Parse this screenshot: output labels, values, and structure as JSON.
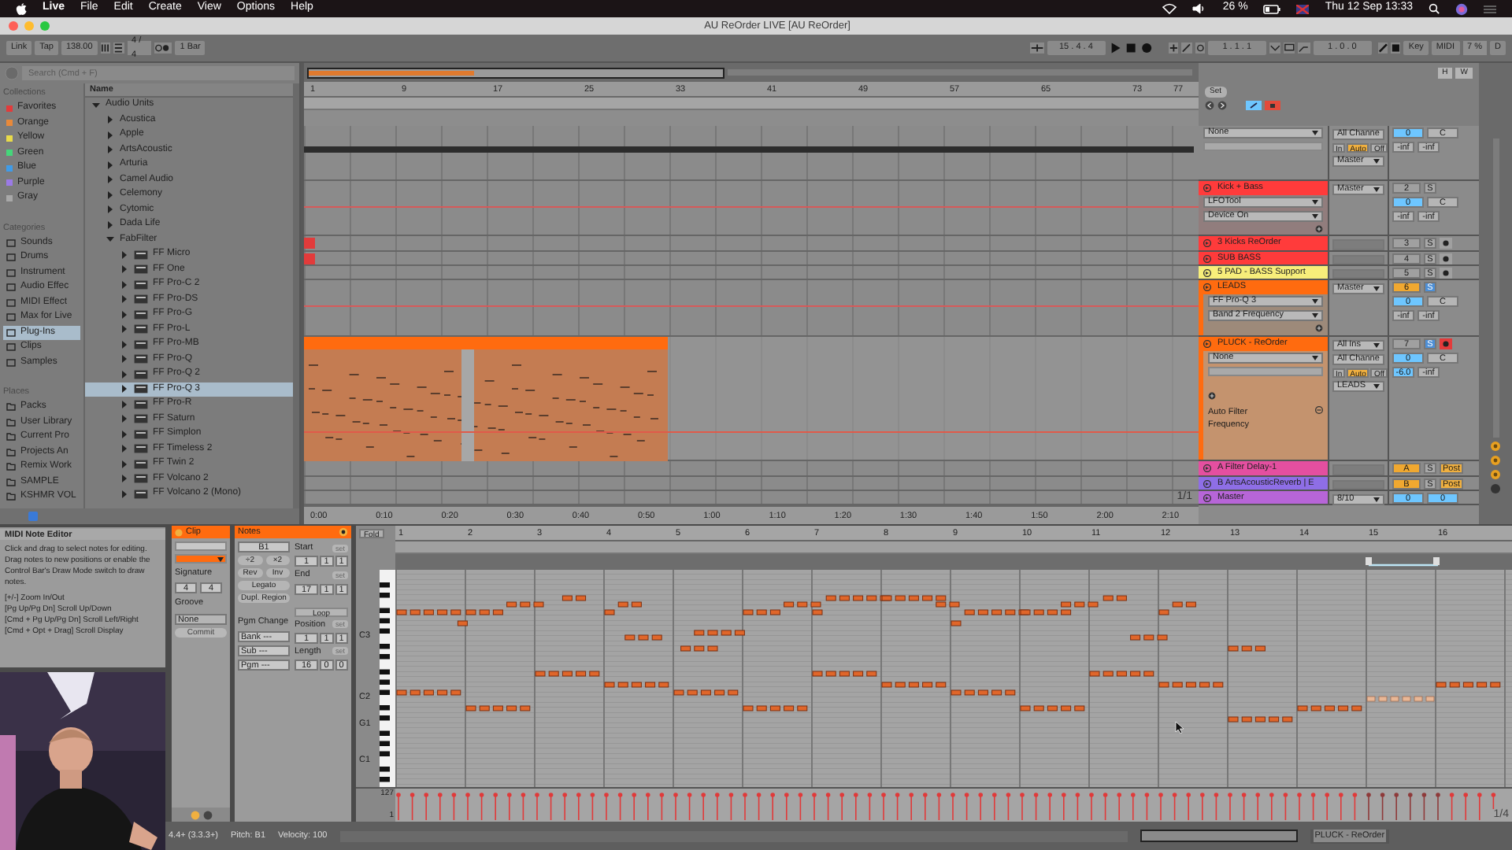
{
  "menubar": {
    "items": [
      "Live",
      "File",
      "Edit",
      "Create",
      "View",
      "Options",
      "Help"
    ],
    "battery": "26 %",
    "clock": "Thu 12 Sep 13:33"
  },
  "window": {
    "title": "AU ReOrder LIVE  [AU ReOrder]"
  },
  "control_bar": {
    "link": "Link",
    "tap": "Tap",
    "tempo": "138.00",
    "sig_num": "4",
    "sig_sep": "/",
    "sig_den": "4",
    "quantize": "1 Bar",
    "position": "15 .  4 .  4",
    "loop_start": "1 .  1 .  1",
    "loop_length": "1 .  0 .  0",
    "key": "Key",
    "midi": "MIDI",
    "cpu": "7 %",
    "disk": "D"
  },
  "browser": {
    "search_placeholder": "Search (Cmd + F)",
    "collections_title": "Collections",
    "collections": [
      {
        "label": "Favorites",
        "color": "#e23b3b"
      },
      {
        "label": "Orange",
        "color": "#e8893a"
      },
      {
        "label": "Yellow",
        "color": "#e8da4a"
      },
      {
        "label": "Green",
        "color": "#45d67a"
      },
      {
        "label": "Blue",
        "color": "#3f9be8"
      },
      {
        "label": "Purple",
        "color": "#9b7ae6"
      },
      {
        "label": "Gray",
        "color": "#a8a8a8"
      }
    ],
    "categories_title": "Categories",
    "categories": [
      {
        "label": "Sounds",
        "selected": false
      },
      {
        "label": "Drums",
        "selected": false
      },
      {
        "label": "Instrument",
        "selected": false
      },
      {
        "label": "Audio Effec",
        "selected": false
      },
      {
        "label": "MIDI Effect",
        "selected": false
      },
      {
        "label": "Max for Live",
        "selected": false
      },
      {
        "label": "Plug-Ins",
        "selected": true
      },
      {
        "label": "Clips",
        "selected": false
      },
      {
        "label": "Samples",
        "selected": false
      }
    ],
    "places_title": "Places",
    "places": [
      "Packs",
      "User Library",
      "Current Pro",
      "Projects An",
      "Remix Work",
      "SAMPLE",
      "KSHMR VOL"
    ],
    "column": "Name",
    "tree": [
      {
        "label": "Audio Units",
        "kind": "folder",
        "expanded": true,
        "selected": false,
        "children": [
          {
            "label": "Acustica",
            "kind": "folder",
            "expanded": false,
            "selected": false
          },
          {
            "label": "Apple",
            "kind": "folder",
            "expanded": false,
            "selected": false
          },
          {
            "label": "ArtsAcoustic",
            "kind": "folder",
            "expanded": false,
            "selected": false
          },
          {
            "label": "Arturia",
            "kind": "folder",
            "expanded": false,
            "selected": false
          },
          {
            "label": "Camel Audio",
            "kind": "folder",
            "expanded": false,
            "selected": false
          },
          {
            "label": "Celemony",
            "kind": "folder",
            "expanded": false,
            "selected": false
          },
          {
            "label": "Cytomic",
            "kind": "folder",
            "expanded": false,
            "selected": false
          },
          {
            "label": "Dada Life",
            "kind": "folder",
            "expanded": false,
            "selected": false
          },
          {
            "label": "FabFilter",
            "kind": "folder",
            "expanded": true,
            "selected": false,
            "children": [
              {
                "label": "FF Micro",
                "kind": "plugin",
                "expanded": false,
                "selected": false
              },
              {
                "label": "FF One",
                "kind": "plugin",
                "expanded": false,
                "selected": false
              },
              {
                "label": "FF Pro-C 2",
                "kind": "plugin",
                "expanded": false,
                "selected": false
              },
              {
                "label": "FF Pro-DS",
                "kind": "plugin",
                "expanded": false,
                "selected": false
              },
              {
                "label": "FF Pro-G",
                "kind": "plugin",
                "expanded": false,
                "selected": false
              },
              {
                "label": "FF Pro-L",
                "kind": "plugin",
                "expanded": false,
                "selected": false
              },
              {
                "label": "FF Pro-MB",
                "kind": "plugin",
                "expanded": false,
                "selected": false
              },
              {
                "label": "FF Pro-Q",
                "kind": "plugin",
                "expanded": false,
                "selected": false
              },
              {
                "label": "FF Pro-Q 2",
                "kind": "plugin",
                "expanded": false,
                "selected": false
              },
              {
                "label": "FF Pro-Q 3",
                "kind": "plugin",
                "expanded": false,
                "selected": true
              },
              {
                "label": "FF Pro-R",
                "kind": "plugin",
                "expanded": false,
                "selected": false
              },
              {
                "label": "FF Saturn",
                "kind": "plugin",
                "expanded": false,
                "selected": false
              },
              {
                "label": "FF Simplon",
                "kind": "plugin",
                "expanded": false,
                "selected": false
              },
              {
                "label": "FF Timeless 2",
                "kind": "plugin",
                "expanded": false,
                "selected": false
              },
              {
                "label": "FF Twin 2",
                "kind": "plugin",
                "expanded": false,
                "selected": false
              },
              {
                "label": "FF Volcano 2",
                "kind": "plugin",
                "expanded": false,
                "selected": false
              },
              {
                "label": "FF Volcano 2 (Mono)",
                "kind": "plugin",
                "expanded": false,
                "selected": false
              }
            ]
          }
        ]
      }
    ]
  },
  "arrangement": {
    "bar_numbers": [
      "1",
      "9",
      "17",
      "25",
      "33",
      "41",
      "49",
      "57",
      "65",
      "73",
      "77"
    ],
    "time_labels": [
      "0:00",
      "0:10",
      "0:20",
      "0:30",
      "0:40",
      "0:50",
      "1:00",
      "1:10",
      "1:20",
      "1:30",
      "1:40",
      "1:50",
      "2:00",
      "2:10"
    ],
    "zoom_label": "1/1",
    "overview_buttons": [
      "H",
      "W"
    ],
    "set": "Set"
  },
  "tracks": [
    {
      "kind": "track",
      "devices": [
        "None"
      ],
      "io": [
        {
          "kind": "dropdown",
          "label": "All Channe"
        },
        {
          "kind": "monitor",
          "options": [
            {
              "label": "In",
              "selected": false
            },
            {
              "label": "Auto",
              "selected": true
            },
            {
              "label": "Off",
              "selected": false
            }
          ]
        },
        {
          "kind": "dropdown",
          "label": "Master"
        }
      ],
      "volume": "0",
      "pan": "C",
      "peaks": [
        "-inf",
        "-inf"
      ],
      "clip": {
        "kind": "strip"
      }
    },
    {
      "kind": "group",
      "name": "Kick + Bass",
      "color": "#ff3b3b",
      "devices": [
        "LFOTool",
        "Device On"
      ],
      "io": [
        {
          "kind": "dropdown",
          "label": "Master"
        }
      ],
      "number": "2",
      "number_active": false,
      "solo": {
        "label": "S",
        "on": false
      },
      "volume": "0",
      "pan": "C",
      "peaks": [
        "-inf",
        "-inf"
      ]
    },
    {
      "kind": "track",
      "name": "3 Kicks ReOrder",
      "color": "#ff3b3b",
      "number": "3",
      "number_active": false,
      "solo": {
        "label": "S",
        "on": false
      },
      "arm": false,
      "clip": {
        "kind": "short"
      }
    },
    {
      "kind": "track",
      "name": "SUB BASS",
      "color": "#ff3b3b",
      "number": "4",
      "number_active": false,
      "solo": {
        "label": "S",
        "on": false
      },
      "arm": false,
      "clip": {
        "kind": "short"
      }
    },
    {
      "kind": "track",
      "name": "5 PAD - BASS Support",
      "color": "#f7ee7a",
      "number": "5",
      "number_active": false,
      "solo": {
        "label": "S",
        "on": false
      },
      "arm": false
    },
    {
      "kind": "group",
      "name": "LEADS",
      "color": "#ff6b0f",
      "devices": [
        "FF Pro-Q 3",
        "Band 2 Frequency"
      ],
      "io": [
        {
          "kind": "dropdown",
          "label": "Master"
        }
      ],
      "number": "6",
      "number_active": true,
      "solo": {
        "label": "S",
        "on": true
      },
      "volume": "0",
      "pan": "C",
      "peaks": [
        "-inf",
        "-inf"
      ]
    },
    {
      "kind": "track",
      "name": "PLUCK - ReOrder",
      "color": "#ff6b0f",
      "devices": [
        "None"
      ],
      "automation": [
        "Auto Filter",
        "Frequency"
      ],
      "io": [
        {
          "kind": "dropdown",
          "label": "All Ins"
        },
        {
          "kind": "dropdown",
          "label": "All Channe"
        },
        {
          "kind": "monitor",
          "options": [
            {
              "label": "In",
              "selected": false
            },
            {
              "label": "Auto",
              "selected": true
            },
            {
              "label": "Off",
              "selected": false
            }
          ]
        },
        {
          "kind": "dropdown",
          "label": "LEADS"
        }
      ],
      "number": "7",
      "number_active": false,
      "solo": {
        "label": "S",
        "on": true
      },
      "arm": true,
      "volume": "0",
      "pan": "C",
      "peaks": [
        "-6.0",
        "-inf"
      ],
      "clip": {
        "kind": "long"
      }
    },
    {
      "kind": "return",
      "name": "A Filter Delay-1",
      "color": "#e44fa0",
      "number": "A",
      "number_active": true,
      "solo": {
        "label": "S",
        "on": false
      },
      "post": "Post"
    },
    {
      "kind": "return",
      "name": "B ArtsAcousticReverb | E",
      "color": "#8e6ee6",
      "number": "B",
      "number_active": true,
      "solo": {
        "label": "S",
        "on": false
      },
      "post": "Post"
    },
    {
      "kind": "master",
      "name": "Master",
      "color": "#b765d8",
      "io": [
        {
          "kind": "dropdown",
          "label": "8/10"
        }
      ],
      "volume": "0",
      "pan": "0"
    }
  ],
  "info": {
    "title": "MIDI Note Editor",
    "text": "Click and drag to select notes for editing. Drag notes to new positions or enable the Control Bar's Draw Mode switch to draw notes.",
    "shortcuts": [
      "[+/-] Zoom In/Out",
      "[Pg Up/Pg Dn] Scroll Up/Down",
      "[Cmd + Pg Up/Pg Dn] Scroll Left/Right",
      "[Cmd + Opt + Drag] Scroll Display"
    ]
  },
  "clip_view": {
    "title": "Clip",
    "signature_label": "Signature",
    "sig_num": "4",
    "sig_den": "4",
    "groove_label": "Groove",
    "groove": "None",
    "commit": "Commit"
  },
  "notes_view": {
    "title": "Notes",
    "pitch": "B1",
    "half": "÷2",
    "double": "×2",
    "rev": "Rev",
    "inv": "Inv",
    "legato": "Legato",
    "dupl": "Dupl. Region",
    "pgm_change": "Pgm Change",
    "bank": "Bank ---",
    "sub": "Sub ---",
    "pgm": "Pgm ---",
    "loop": "Loop",
    "fields": [
      {
        "label": "Start",
        "set": "set",
        "values": [
          "1",
          "1",
          "1"
        ]
      },
      {
        "label": "End",
        "set": "set",
        "values": [
          "17",
          "1",
          "1"
        ]
      },
      {
        "label": "Position",
        "set": "set",
        "values": [
          "1",
          "1",
          "1"
        ]
      },
      {
        "label": "Length",
        "set": "set",
        "values": [
          "16",
          "0",
          "0"
        ]
      }
    ]
  },
  "piano_roll": {
    "fold": "Fold",
    "bars": [
      "1",
      "2",
      "3",
      "4",
      "5",
      "6",
      "7",
      "8",
      "9",
      "10",
      "11",
      "12",
      "13",
      "14",
      "15",
      "16"
    ],
    "key_labels": [
      "C3",
      "C2",
      "G1",
      "C1"
    ],
    "velocity_max": "127",
    "velocity_min": "1",
    "grid": "1/4"
  },
  "status_bar": {
    "position": "4.4+ (3.3.3+)",
    "pitch": "Pitch: B1",
    "velocity": "Velocity: 100",
    "track": "PLUCK - ReOrder"
  }
}
